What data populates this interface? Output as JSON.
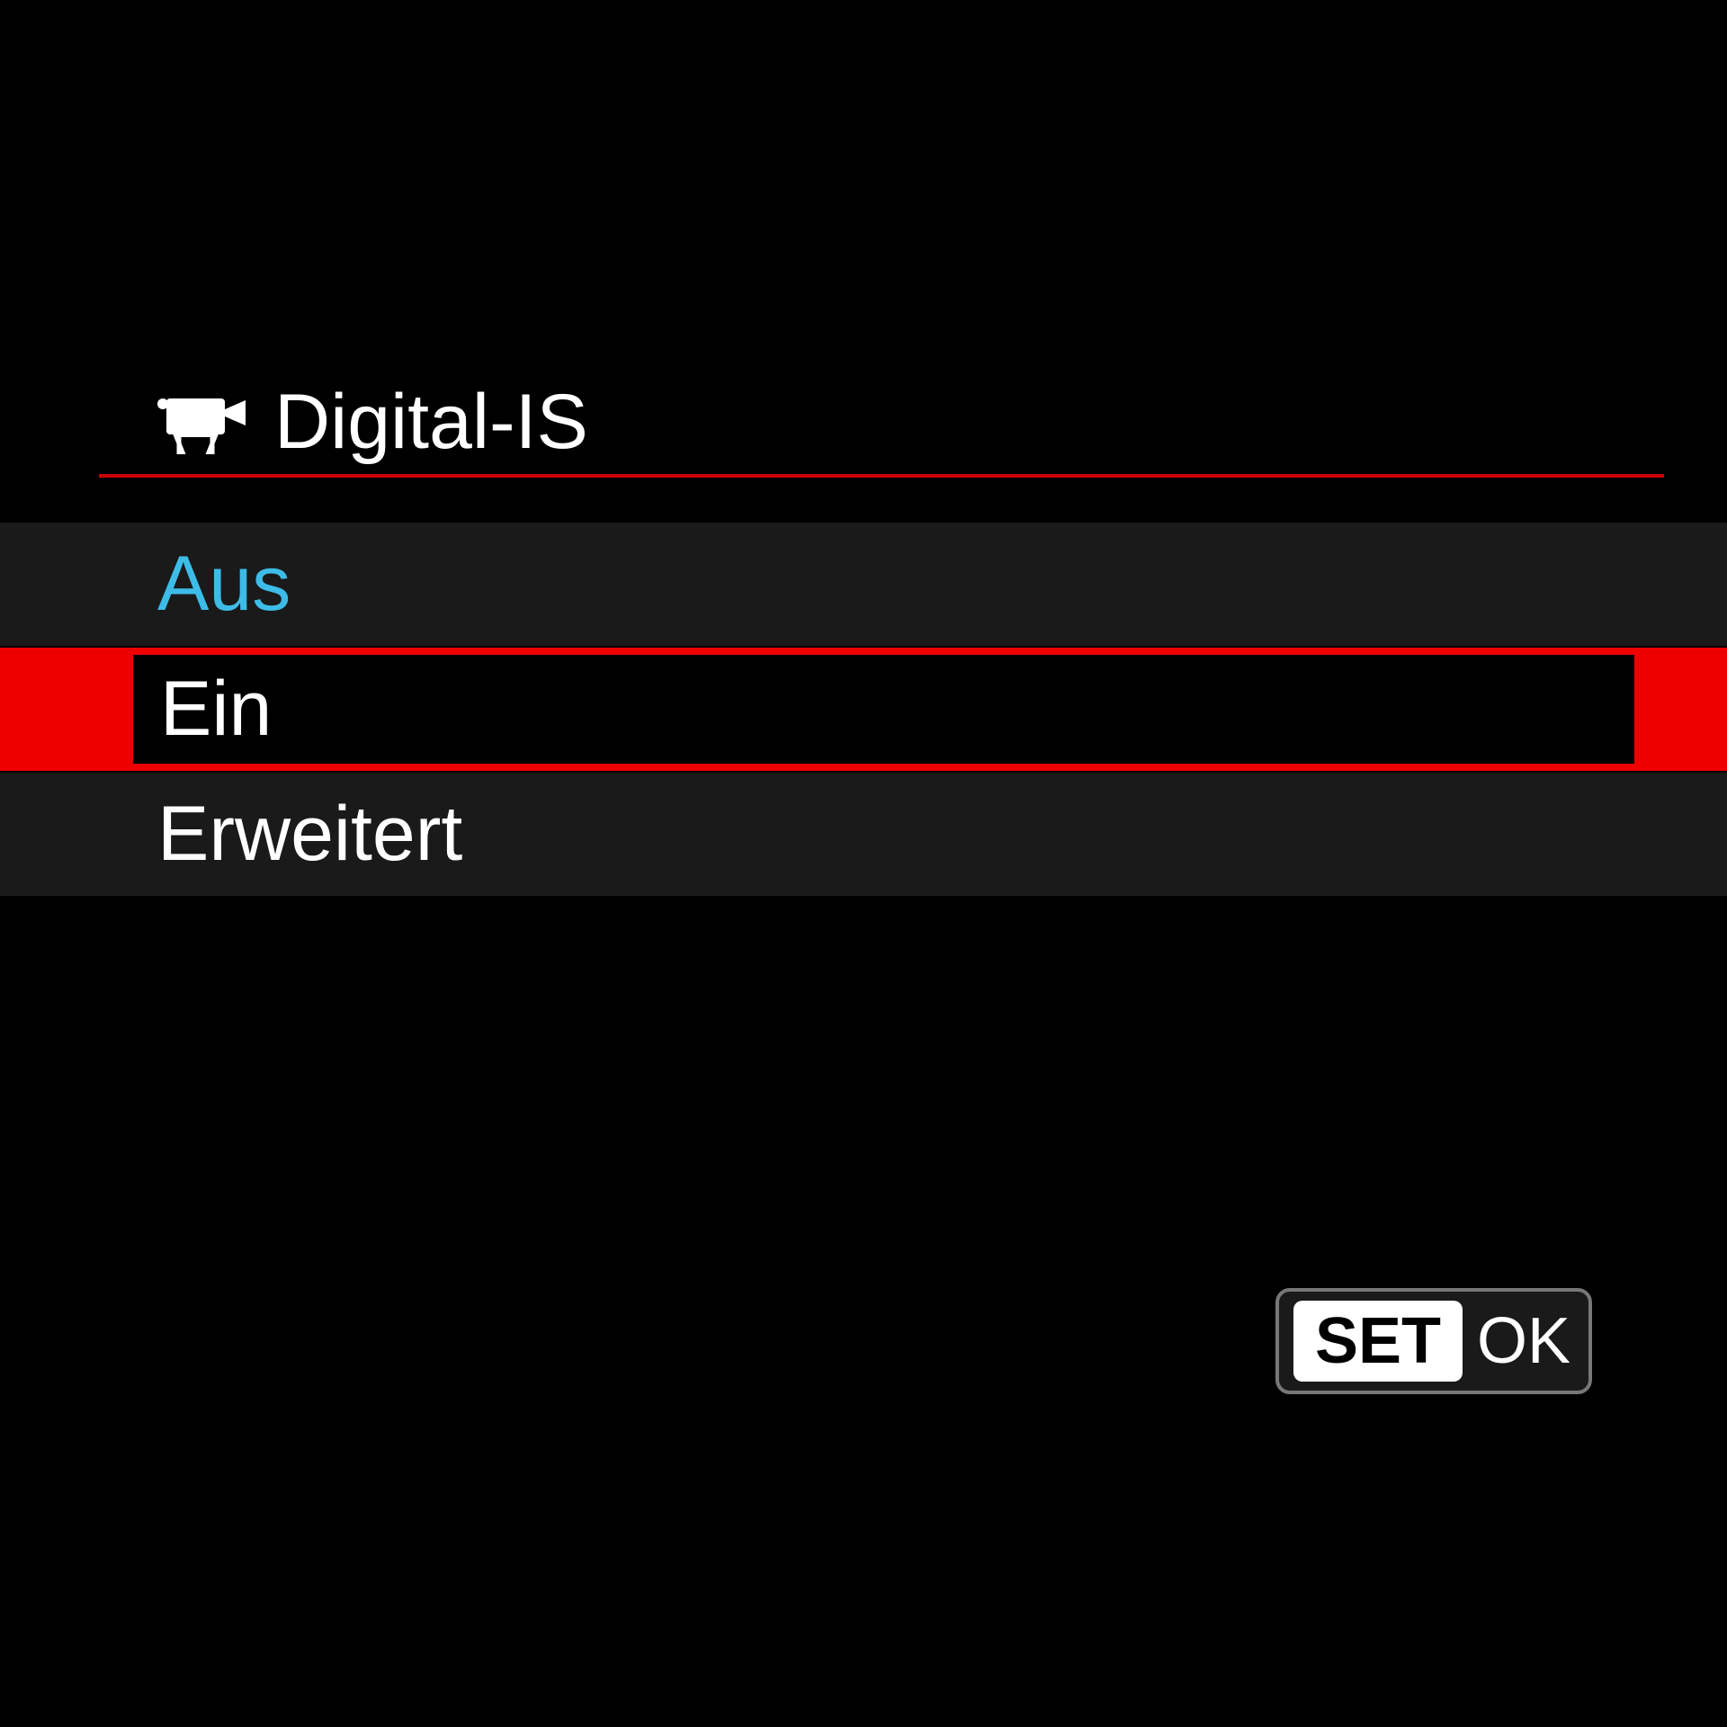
{
  "header": {
    "title": "Digital-IS",
    "icon": "movie-camera-icon"
  },
  "options": [
    {
      "label": "Aus",
      "state": "current-value"
    },
    {
      "label": "Ein",
      "state": "selected"
    },
    {
      "label": "Erweitert",
      "state": "normal"
    }
  ],
  "footer": {
    "set_label": "SET",
    "ok_label": "OK"
  }
}
